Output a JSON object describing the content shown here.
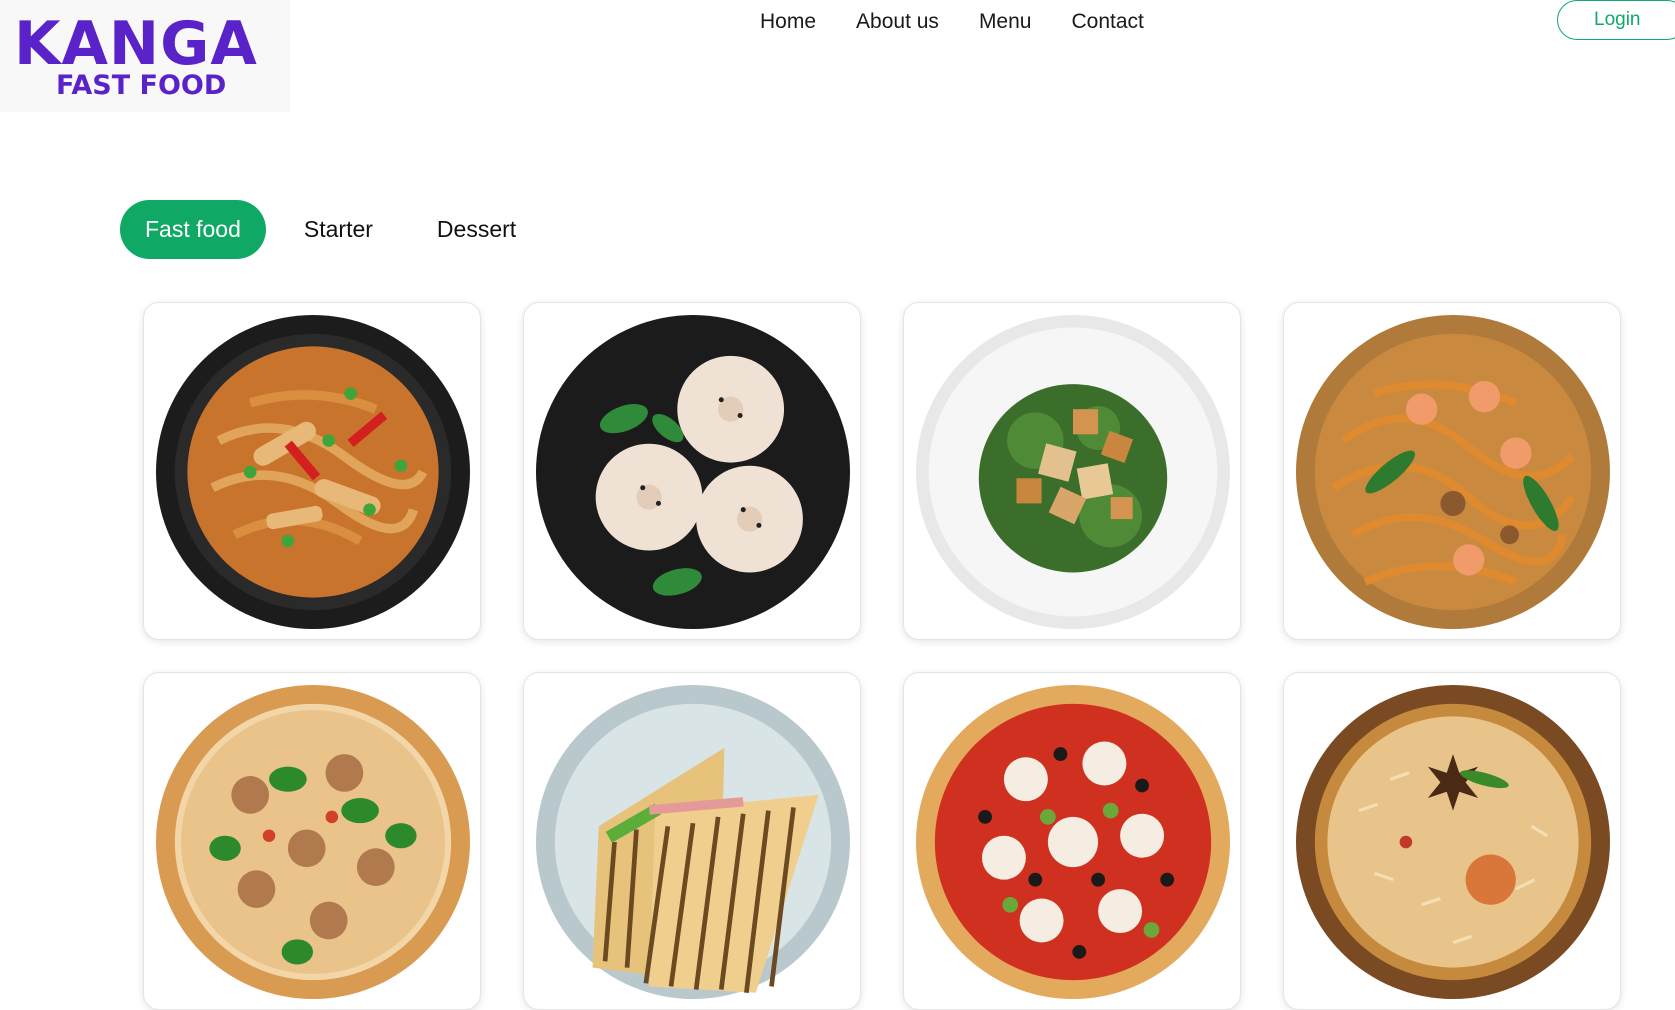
{
  "brand": {
    "name": "KANGA",
    "tagline": "FAST FOOD",
    "color": "#5a22c9"
  },
  "nav": {
    "links": [
      "Home",
      "About us",
      "Menu",
      "Contact"
    ],
    "login_label": "Login"
  },
  "accent": "#10a865",
  "tabs": [
    {
      "label": "Fast food",
      "active": true
    },
    {
      "label": "Starter",
      "active": false
    },
    {
      "label": "Dessert",
      "active": false
    }
  ],
  "dishes": [
    {
      "icon": "noodles-chicken-bowl-image"
    },
    {
      "icon": "dumplings-plate-image"
    },
    {
      "icon": "chicken-salad-plate-image"
    },
    {
      "icon": "shrimp-noodles-plate-image"
    },
    {
      "icon": "mushroom-pizza-image"
    },
    {
      "icon": "grilled-sandwich-plate-image"
    },
    {
      "icon": "pepperoni-olive-pizza-image"
    },
    {
      "icon": "biryani-bowl-image"
    }
  ]
}
